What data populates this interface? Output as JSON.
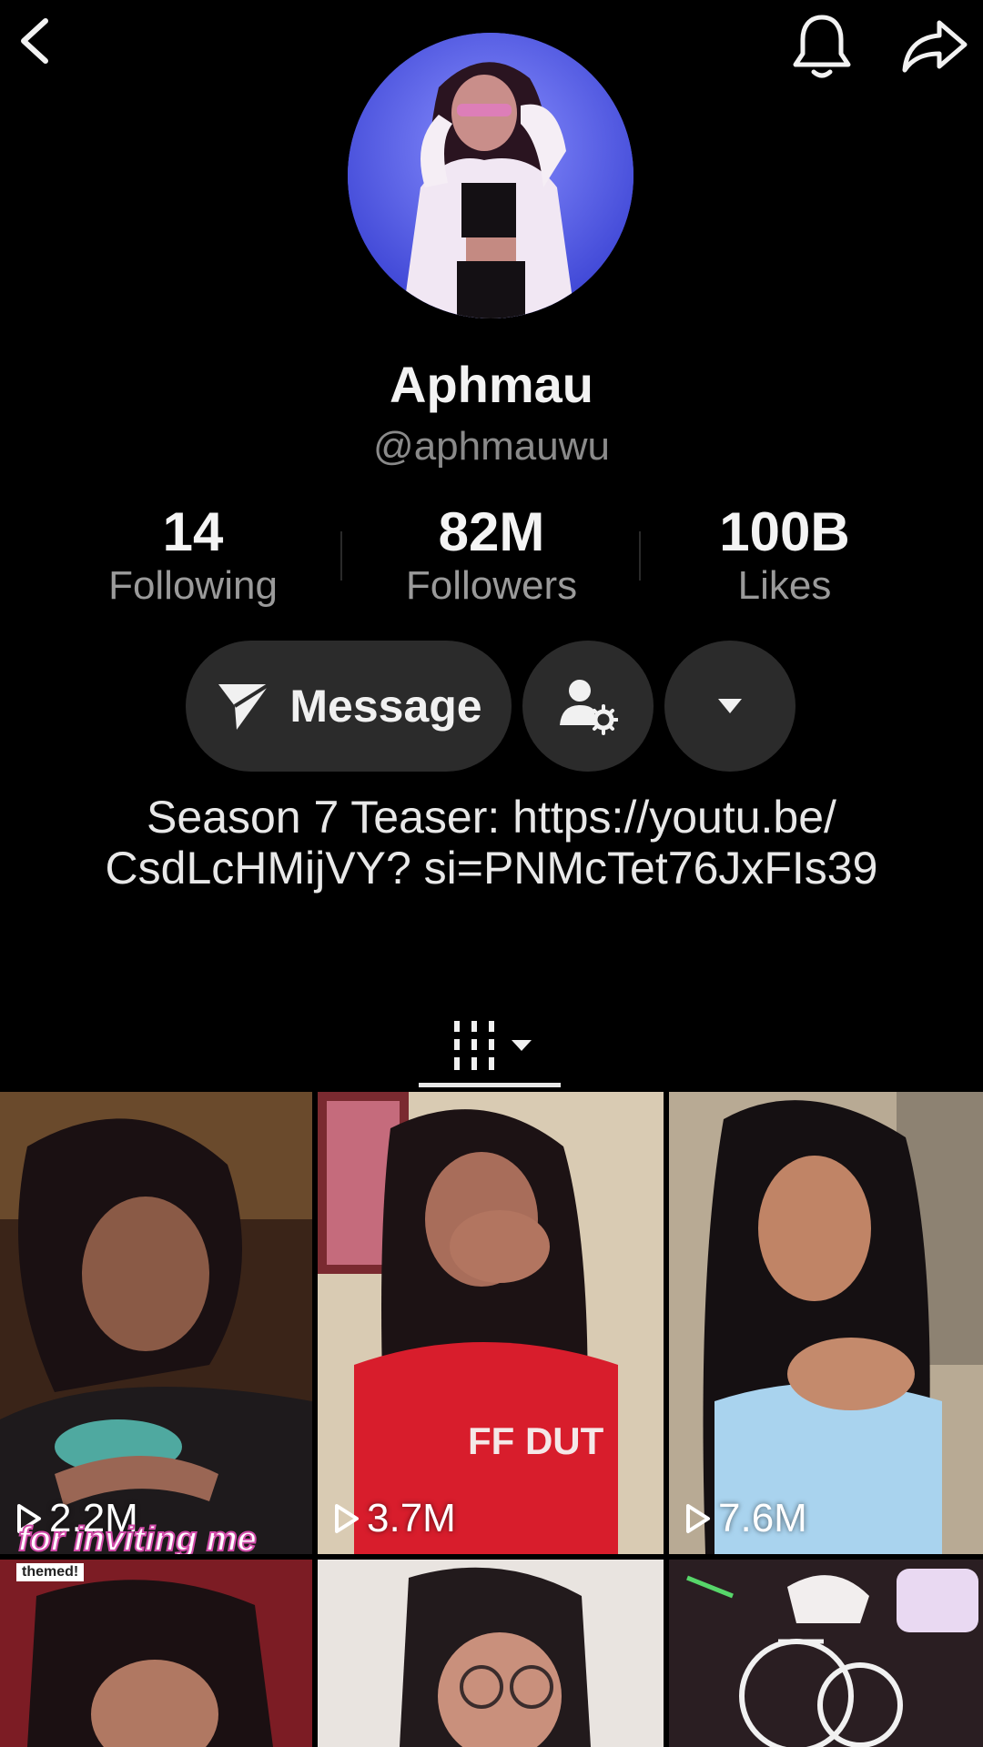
{
  "profile": {
    "display_name": "Aphmau",
    "handle": "@aphmauwu",
    "bio": "Season 7 Teaser: https://youtu.be/ CsdLcHMijVY? si=PNMcTet76JxFIs39"
  },
  "stats": {
    "following_count": "14",
    "following_label": "Following",
    "followers_count": "82M",
    "followers_label": "Followers",
    "likes_count": "100B",
    "likes_label": "Likes"
  },
  "actions": {
    "message_label": "Message"
  },
  "icons": {
    "back": "chevron-left-icon",
    "notifications": "bell-icon",
    "share": "share-arrow-icon",
    "message": "paper-plane-icon",
    "add_friend": "person-gear-icon",
    "more": "caret-down-icon",
    "tab": "grid-columns-icon"
  },
  "videos": [
    {
      "views": "2.2M",
      "caption": "for inviting me",
      "tag": "themed!"
    },
    {
      "views": "3.7M",
      "shirt_text": "FF DUT"
    },
    {
      "views": "7.6M"
    },
    {
      "views": ""
    },
    {
      "views": ""
    },
    {
      "views": ""
    }
  ],
  "colors": {
    "background": "#000000",
    "button_bg": "#2b2b2b",
    "muted_text": "#8a8a8a",
    "avatar_bg": "#5a63f2"
  }
}
